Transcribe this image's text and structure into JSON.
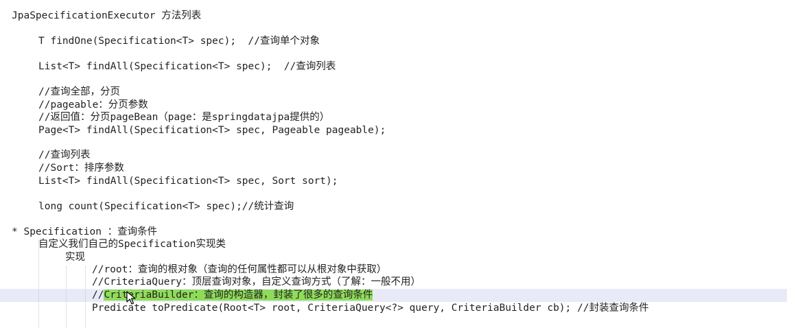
{
  "lines": {
    "l1": "JpaSpecificationExecutor 方法列表",
    "l2": "T findOne(Specification<T> spec);  //查询单个对象",
    "l3": "List<T> findAll(Specification<T> spec);  //查询列表",
    "l4": "//查询全部，分页",
    "l5": "//pageable：分页参数",
    "l6": "//返回值：分页pageBean（page：是springdatajpa提供的）",
    "l7": "Page<T> findAll(Specification<T> spec, Pageable pageable);",
    "l8": "//查询列表",
    "l9": "//Sort：排序参数",
    "l10": "List<T> findAll(Specification<T> spec, Sort sort);",
    "l11": "long count(Specification<T> spec);//统计查询",
    "l12": "* Specification ：查询条件",
    "l13": "自定义我们自己的Specification实现类",
    "l14": "实现",
    "l15": "//root：查询的根对象（查询的任何属性都可以从根对象中获取）",
    "l16": "//CriteriaQuery：顶层查询对象，自定义查询方式（了解：一般不用）",
    "l17_prefix": "//",
    "l17_selected": "CriteriaBuilder：查询的构造器，封装了很多的查询条件",
    "l18": "Predicate toPredicate(Root<T> root, CriteriaQuery<?> query, CriteriaBuilder cb); //封装查询条件"
  },
  "colors": {
    "selection": "#8fdc5a",
    "current_line": "#e8eaf7",
    "indent_guide": "#c8c8c8",
    "text": "#222222"
  },
  "icons": {
    "cursor": "mouse-pointer-icon"
  }
}
